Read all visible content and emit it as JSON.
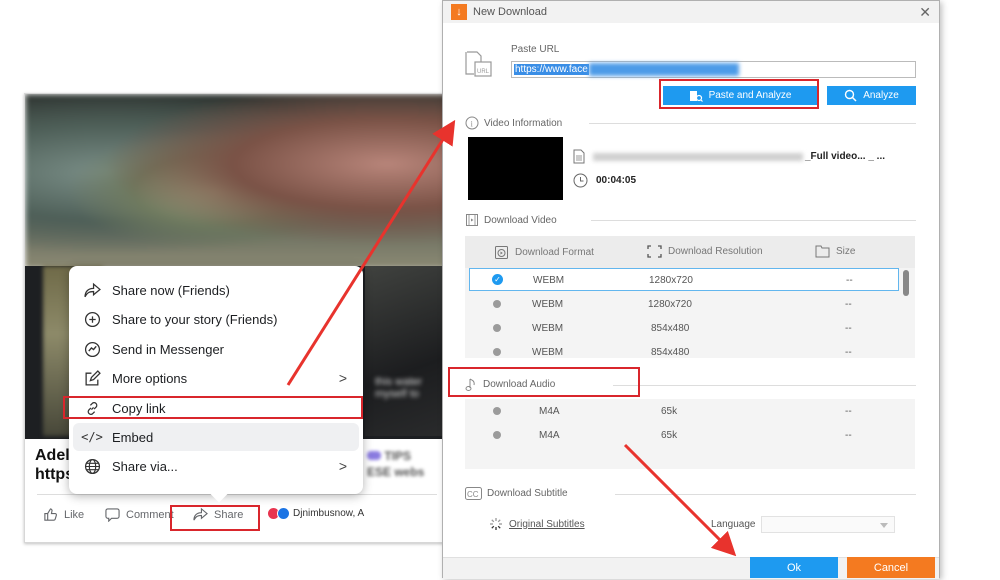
{
  "facebook": {
    "menu_items": [
      {
        "label": "Share now (Friends)",
        "icon": "share-arrow-icon",
        "has_submenu": false
      },
      {
        "label": "Share to your story (Friends)",
        "icon": "plus-circle-icon",
        "has_submenu": false
      },
      {
        "label": "Send in Messenger",
        "icon": "messenger-icon",
        "has_submenu": false
      },
      {
        "label": "More options",
        "icon": "edit-icon",
        "has_submenu": true
      },
      {
        "label": "Copy link",
        "icon": "link-icon",
        "has_submenu": false
      },
      {
        "label": "Embed",
        "icon": "code-icon",
        "has_submenu": false
      },
      {
        "label": "Share via...",
        "icon": "globe-icon",
        "has_submenu": true
      }
    ],
    "caption_line1": "Adel",
    "caption_line2": "https:",
    "actions": {
      "like": "Like",
      "comment": "Comment",
      "share": "Share"
    },
    "reactions_text": "Djnimbusnow, A",
    "submenu_chevron": ">"
  },
  "dialog": {
    "title": "New Download",
    "close_glyph": "✕",
    "paste_url_label": "Paste URL",
    "url_value": "https://www.face",
    "paste_and_analyze": "Paste and Analyze",
    "analyze": "Analyze",
    "video_info_label": "Video Information",
    "video_title_suffix": "_Full video... _ ...",
    "duration": "00:04:05",
    "download_video_label": "Download Video",
    "columns": {
      "format": "Download Format",
      "resolution": "Download Resolution",
      "size": "Size"
    },
    "video_rows": [
      {
        "format": "WEBM",
        "resolution": "1280x720",
        "size": "--",
        "selected": true
      },
      {
        "format": "WEBM",
        "resolution": "1280x720",
        "size": "--",
        "selected": false
      },
      {
        "format": "WEBM",
        "resolution": "854x480",
        "size": "--",
        "selected": false
      },
      {
        "format": "WEBM",
        "resolution": "854x480",
        "size": "--",
        "selected": false
      }
    ],
    "download_audio_label": "Download Audio",
    "audio_rows": [
      {
        "format": "M4A",
        "bitrate": "65k",
        "size": "--"
      },
      {
        "format": "M4A",
        "bitrate": "65k",
        "size": "--"
      }
    ],
    "download_subtitle_label": "Download Subtitle",
    "original_subtitles": "Original Subtitles",
    "language_label": "Language",
    "language_value": "",
    "ok": "Ok",
    "cancel": "Cancel"
  },
  "colors": {
    "accent_blue": "#1e9af0",
    "accent_orange": "#f47a20",
    "annotation_red": "#d9262c"
  }
}
